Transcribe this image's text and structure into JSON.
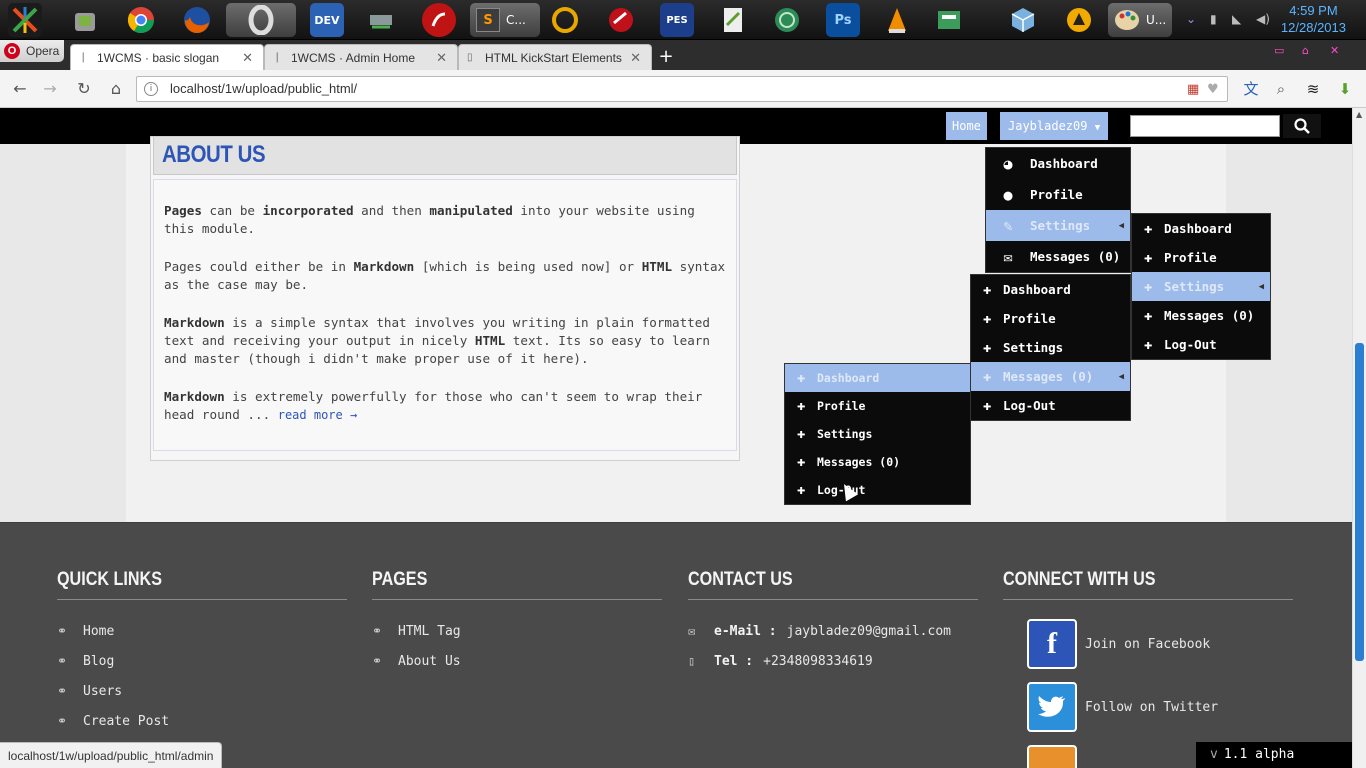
{
  "taskbar": {
    "icons": [
      {
        "name": "xfast-icon",
        "label": "",
        "color": "#222"
      },
      {
        "name": "android-icon",
        "label": "",
        "color": "#777"
      },
      {
        "name": "chrome-icon",
        "label": "",
        "color": "#db4437"
      },
      {
        "name": "firefox-icon",
        "label": "",
        "color": "#e66000"
      },
      {
        "name": "opera-icon",
        "label": "O",
        "color": "#555"
      },
      {
        "name": "devcpp-icon",
        "label": "DEV",
        "color": "#2b62b4"
      },
      {
        "name": "drive-icon",
        "label": "",
        "color": "#6e7f80"
      },
      {
        "name": "sublime-tray-icon",
        "label": "",
        "color": "#c01414"
      },
      {
        "name": "sublime-text-icon",
        "label": "S",
        "color": "#555"
      },
      {
        "name": "headset-icon",
        "label": "",
        "color": "#e8a800"
      },
      {
        "name": "record-icon",
        "label": "",
        "color": "#c0101a"
      },
      {
        "name": "pes-icon",
        "label": "PES",
        "color": "#1d3e8a"
      },
      {
        "name": "notepad-icon",
        "label": "",
        "color": "#5aa02c"
      },
      {
        "name": "globe-icon",
        "label": "",
        "color": "#2e8b57"
      },
      {
        "name": "photoshop-icon",
        "label": "Ps",
        "color": "#0a4f9d"
      },
      {
        "name": "vlc-icon",
        "label": "",
        "color": "#f08c00"
      },
      {
        "name": "printer-icon",
        "label": "",
        "color": "#3c9c5c"
      },
      {
        "name": "cube-icon",
        "label": "",
        "color": "#7ab1de"
      },
      {
        "name": "aimp-icon",
        "label": "",
        "color": "#f2a900"
      },
      {
        "name": "paint-icon",
        "label": "",
        "color": "#d98e2c"
      }
    ],
    "active_label_1": "C...",
    "active_label_2": "U...",
    "clock_time": "4:59 PM",
    "clock_date": "12/28/2013"
  },
  "browser": {
    "menu_label": "Opera",
    "tabs": [
      {
        "title": "1WCMS · basic slogan",
        "active": true
      },
      {
        "title": "1WCMS · Admin Home",
        "active": false
      },
      {
        "title": "HTML KickStart Elements",
        "active": false
      }
    ],
    "url": "localhost/1w/upload/public_html/",
    "status_url": "localhost/1w/upload/public_html/admin"
  },
  "site": {
    "nav_home": "Home",
    "nav_user": "Jaybladez09",
    "search_placeholder": ""
  },
  "about": {
    "title": "ABOUT US",
    "p1": {
      "a": "Pages",
      "b": " can be ",
      "c": "incorporated",
      "d": " and then ",
      "e": "manipulated",
      "f": " into your website using this module."
    },
    "p2": {
      "a": "Pages could either be in ",
      "b": "Markdown",
      "c": " [which is being used now] or ",
      "d": "HTML",
      "e": " syntax as the case may be."
    },
    "p3": {
      "a": "Markdown",
      "b": " is a simple syntax that involves you writing in plain formatted text and receiving your output in nicely ",
      "c": "HTML",
      "d": " text. Its so easy to learn and master (though i didn't make proper use of it here)."
    },
    "p4": {
      "a": "Markdown",
      "b": " is extremely powerfully for those who can't seem to wrap their head round ... ",
      "link": "read more →"
    }
  },
  "menus": {
    "main": [
      {
        "label": "Dashboard",
        "icon": "dashboard-icon"
      },
      {
        "label": "Profile",
        "icon": "user-icon"
      },
      {
        "label": "Settings",
        "icon": "wrench-icon"
      },
      {
        "label": "Messages (0)",
        "icon": "envelope-icon"
      }
    ],
    "sub1": [
      "Dashboard",
      "Profile",
      "Settings",
      "Messages (0)",
      "Log-Out"
    ],
    "sub2": [
      "Dashboard",
      "Profile",
      "Settings",
      "Messages (0)",
      "Log-Out"
    ],
    "sub3": [
      "Dashboard",
      "Profile",
      "Settings",
      "Messages (0)",
      "Log-Out"
    ]
  },
  "footer": {
    "quick_links": {
      "title": "QUICK LINKS",
      "items": [
        "Home",
        "Blog",
        "Users",
        "Create Post"
      ]
    },
    "pages": {
      "title": "PAGES",
      "items": [
        "HTML Tag",
        "About Us"
      ]
    },
    "contact": {
      "title": "CONTACT US",
      "email_label": "e-Mail :",
      "email": "jaybladez09@gmail.com",
      "tel_label": "Tel :",
      "tel": "+2348098334619"
    },
    "connect": {
      "title": "CONNECT WITH US",
      "facebook": "Join on Facebook",
      "twitter": "Follow on Twitter",
      "facebook_color": "#2d55b7",
      "twitter_color": "#2b8fd9"
    },
    "version_prefix": "v",
    "version": "1.1 alpha"
  },
  "colors": {
    "accent": "#9cbbea",
    "title_blue": "#2d55b7",
    "footer_bg": "#4a4a4a"
  }
}
